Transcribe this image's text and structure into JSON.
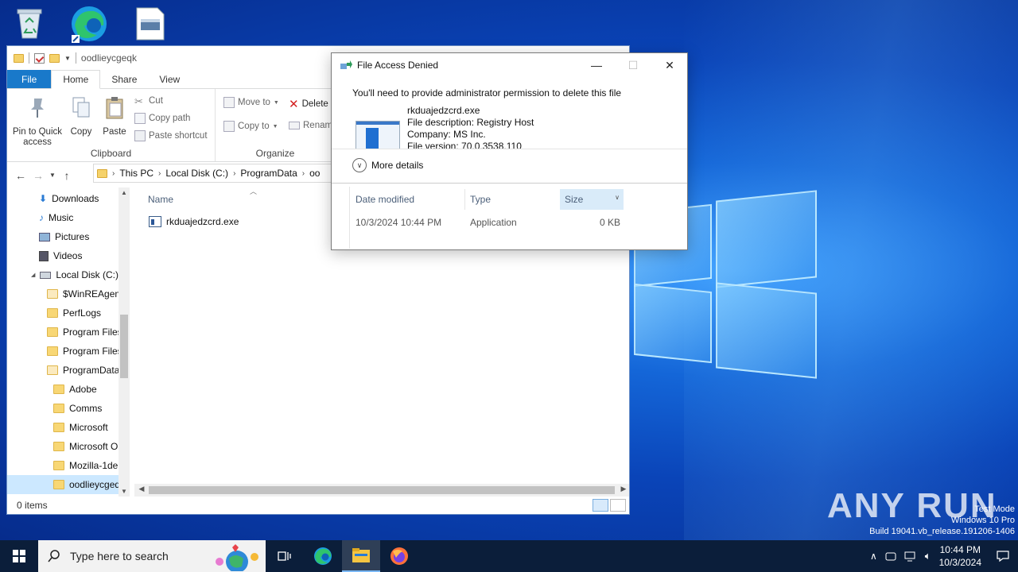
{
  "desktop": {
    "icons": [
      "recycle-bin-icon",
      "edge-icon",
      "file-icon"
    ],
    "watermark_lines": [
      "Test Mode",
      "Windows 10 Pro",
      "Build 19041.vb_release.191206-1406"
    ],
    "brand": "ANY RUN"
  },
  "explorer": {
    "window_title": "oodlieycgeqk",
    "ribbon_tabs": [
      "File",
      "Home",
      "Share",
      "View"
    ],
    "clipboard": {
      "pin_label_1": "Pin to Quick",
      "pin_label_2": "access",
      "copy": "Copy",
      "paste": "Paste",
      "cut": "Cut",
      "copy_path": "Copy path",
      "paste_shortcut": "Paste shortcut",
      "group_label": "Clipboard"
    },
    "organize": {
      "move_to": "Move to",
      "copy_to": "Copy to",
      "delete": "Delete",
      "rename": "Renam",
      "group_label": "Organize"
    },
    "breadcrumb": [
      "This PC",
      "Local Disk (C:)",
      "ProgramData",
      "oo"
    ],
    "nav_items": [
      {
        "label": "Downloads",
        "icon": "downloads-icon"
      },
      {
        "label": "Music",
        "icon": "music-icon"
      },
      {
        "label": "Pictures",
        "icon": "pictures-icon"
      },
      {
        "label": "Videos",
        "icon": "videos-icon"
      },
      {
        "label": "Local Disk (C:)",
        "icon": "drive-icon"
      },
      {
        "label": "$WinREAgent",
        "icon": "folder-icon"
      },
      {
        "label": "PerfLogs",
        "icon": "folder-icon"
      },
      {
        "label": "Program Files",
        "icon": "folder-icon"
      },
      {
        "label": "Program Files",
        "icon": "folder-icon"
      },
      {
        "label": "ProgramData",
        "icon": "folder-icon"
      },
      {
        "label": "Adobe",
        "icon": "folder-icon"
      },
      {
        "label": "Comms",
        "icon": "folder-icon"
      },
      {
        "label": "Microsoft",
        "icon": "folder-icon"
      },
      {
        "label": "Microsoft O",
        "icon": "folder-icon"
      },
      {
        "label": "Mozilla-1de",
        "icon": "folder-icon"
      },
      {
        "label": "oodlieycgeq",
        "icon": "folder-icon"
      }
    ],
    "column_name": "Name",
    "file_name": "rkduajedzcrd.exe",
    "status_items": "0 items"
  },
  "dialog": {
    "title": "File Access Denied",
    "message": "You'll need to provide administrator permission to delete this file",
    "file_name": "rkduajedzcrd.exe",
    "description": "File description: Registry Host",
    "company": "Company: MS Inc.",
    "version": "File version: 70.0.3538.110",
    "more_details": "More details",
    "columns": {
      "date_modified": "Date modified",
      "type": "Type",
      "size": "Size"
    },
    "row": {
      "date_modified": "10/3/2024 10:44 PM",
      "type": "Application",
      "size": "0 KB"
    }
  },
  "taskbar": {
    "search_placeholder": "Type here to search",
    "time": "10:44 PM",
    "date": "10/3/2024"
  }
}
